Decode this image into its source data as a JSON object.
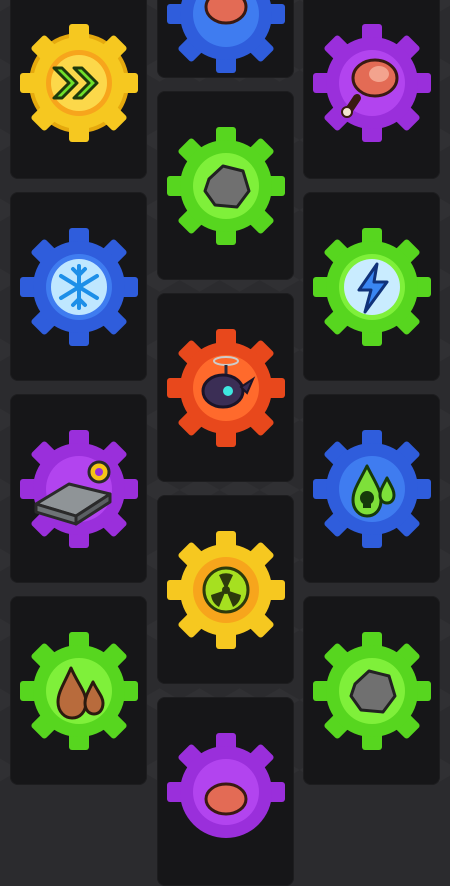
{
  "board": {
    "columns": [
      {
        "id": "left",
        "slots": [
          {
            "gear_color": "#f6c820",
            "ring_color": "#f7a51c",
            "icon": "double-chevron-right-icon"
          },
          {
            "gear_color": "#2f5ddc",
            "ring_color": "#3f7cf0",
            "icon": "snowflake-icon"
          },
          {
            "gear_color": "#9a2fdb",
            "ring_color": "#b244ef",
            "icon": "metal-ingot-gear-icon"
          },
          {
            "gear_color": "#57d61f",
            "ring_color": "#7ff03a",
            "icon": "oil-drops-icon"
          }
        ]
      },
      {
        "id": "middle",
        "slots": [
          {
            "gear_color": "#2f5ddc",
            "ring_color": "#3f7cf0",
            "icon": "meat-icon"
          },
          {
            "gear_color": "#57d61f",
            "ring_color": "#7ff03a",
            "icon": "stone-icon"
          },
          {
            "gear_color": "#e8481c",
            "ring_color": "#ff6a2c",
            "icon": "drone-icon"
          },
          {
            "gear_color": "#f6c820",
            "ring_color": "#f7a51c",
            "icon": "radiation-icon"
          },
          {
            "gear_color": "#9a2fdb",
            "ring_color": "#b244ef",
            "icon": "meat-icon"
          }
        ]
      },
      {
        "id": "right",
        "slots": [
          {
            "gear_color": "#9a2fdb",
            "ring_color": "#b244ef",
            "icon": "meat-icon"
          },
          {
            "gear_color": "#57d61f",
            "ring_color": "#7ff03a",
            "icon": "lightning-icon"
          },
          {
            "gear_color": "#2f5ddc",
            "ring_color": "#3f7cf0",
            "icon": "toxic-drop-icon"
          },
          {
            "gear_color": "#57d61f",
            "ring_color": "#7ff03a",
            "icon": "stone-icon"
          }
        ]
      }
    ]
  }
}
